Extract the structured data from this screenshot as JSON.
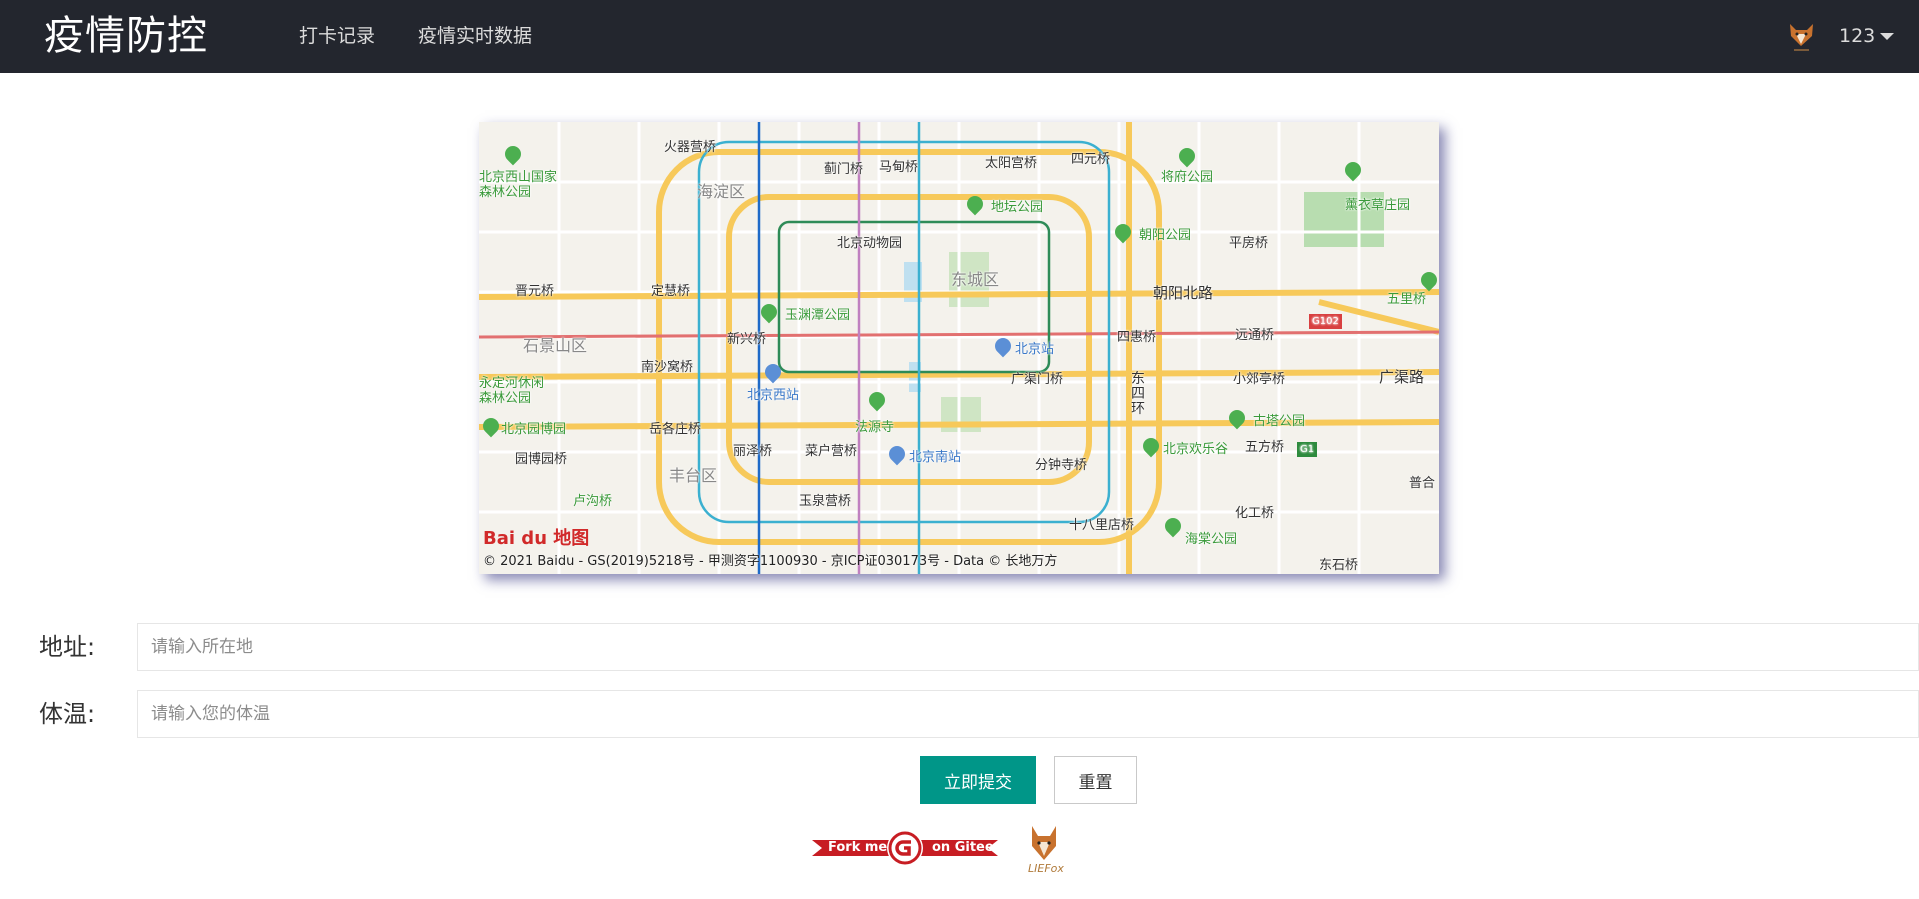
{
  "header": {
    "logo": "疫情防控",
    "nav": [
      {
        "label": "打卡记录"
      },
      {
        "label": "疫情实时数据"
      }
    ],
    "user": {
      "name": "123",
      "avatar_icon": "fox-avatar-icon"
    }
  },
  "map": {
    "provider_logo": "Bai du 地图",
    "copyright": "© 2021 Baidu - GS(2019)5218号 - 甲测资字1100930 - 京ICP证030173号 - Data © 长地万方",
    "labels": {
      "huoqiying": "火器营桥",
      "jimenqiao": "蓟门桥",
      "madianqiao": "马甸桥",
      "taiyanggong": "太阳宫桥",
      "siyuanqiao": "四元桥",
      "jiangfu": "将府公园",
      "haidian": "海淀区",
      "beijingxishan": "北京西山国家森林公园",
      "ditan": "地坛公园",
      "xunyicao": "薰衣草庄园",
      "beijingzoo": "北京动物园",
      "chaoyangpark": "朝阳公园",
      "pingfang": "平房桥",
      "jinyuan": "晋元桥",
      "dinghui": "定慧桥",
      "dongcheng": "东城区",
      "chaoyangbeilu": "朝阳北路",
      "wuliqiao": "五里桥",
      "yuyuantan": "玉渊潭公园",
      "g102": "G102",
      "shijingshan": "石景山区",
      "xinxing": "新兴桥",
      "sihuiqiao": "四惠桥",
      "yuanyuan": "远通桥",
      "beijingstation": "北京站",
      "nanshawo": "南沙窝桥",
      "yongdinghe": "永定河休闲森林公园",
      "guangqumen": "广渠门桥",
      "xiaojiekou": "小郊亭桥",
      "guangqulu": "广渠路",
      "beijingwest": "北京西站",
      "dongsihuan": "东四环",
      "fayuansi": "法源寺",
      "yuegezhuang": "岳各庄桥",
      "guta": "古塔公园",
      "yuanboyuan": "北京园博园",
      "lizeqiao": "丽泽桥",
      "caihuying": "菜户营桥",
      "beijingsouth": "北京南站",
      "fenzhongsi": "分钟寺桥",
      "huanlegu": "北京欢乐谷",
      "wufangqiao": "五方桥",
      "g1": "G1",
      "yuanboyuanqiao": "园博园桥",
      "fengtai": "丰台区",
      "lugou": "卢沟桥",
      "yuquanying": "玉泉营桥",
      "huagong": "化工桥",
      "shibalidian": "十八里店桥",
      "haitang": "海棠公园",
      "puji": "普合",
      "dongdian": "东石桥"
    }
  },
  "form": {
    "address": {
      "label": "地址:",
      "placeholder": "请输入所在地"
    },
    "temperature": {
      "label": "体温:",
      "placeholder": "请输入您的体温"
    },
    "submit_label": "立即提交",
    "reset_label": "重置"
  },
  "footer": {
    "gitee_badge": {
      "part1": "Fork me",
      "part2": "on Gitee",
      "icon": "gitee-icon"
    },
    "fox_logo": {
      "icon": "fox-logo-icon",
      "text": "LIEFox"
    }
  },
  "colors": {
    "header_bg": "#23262e",
    "accent": "#009688",
    "gitee_red": "#c71d23"
  }
}
